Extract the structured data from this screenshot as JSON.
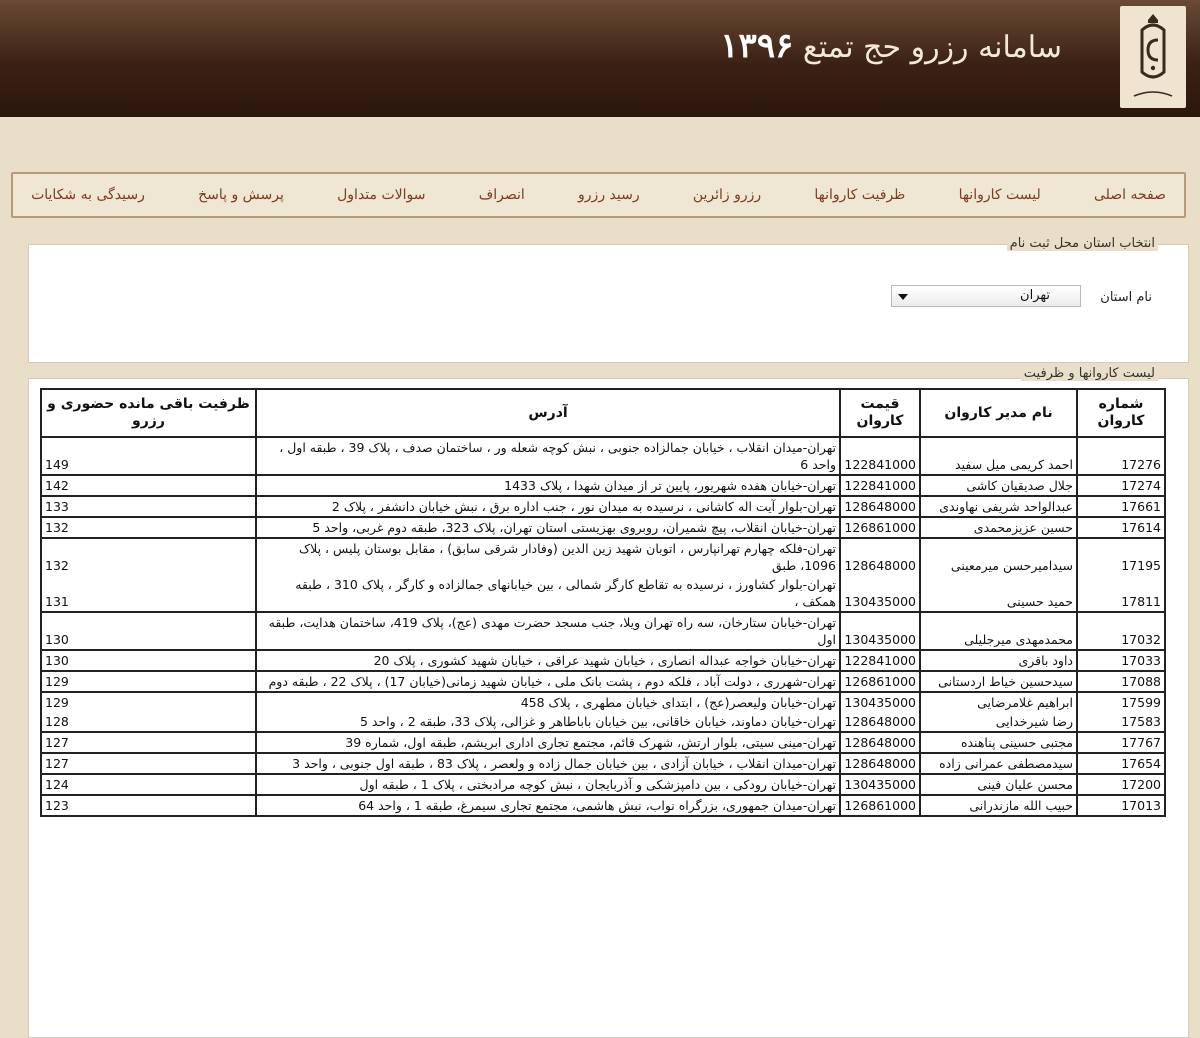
{
  "site": {
    "title": "سامانه رزرو حج تمتع",
    "year": "۱۳۹۶",
    "logo_text": "سازمان حج و زیارت"
  },
  "menu": [
    "صفحه اصلی",
    "لیست کاروانها",
    "ظرفیت کاروانها",
    "رزرو زائرین",
    "رسید رزرو",
    "انصراف",
    "سوالات متداول",
    "پرسش و پاسخ",
    "رسیدگی به شکایات"
  ],
  "province_panel": {
    "legend": "انتخاب استان محل ثبت نام",
    "label": "نام استان",
    "selected": "تهران"
  },
  "list_panel": {
    "legend": "لیست کاروانها و ظرفیت"
  },
  "table": {
    "headers": {
      "number": "شماره کاروان",
      "manager": "نام مدیر کاروان",
      "price": "قیمت کاروان",
      "address": "آدرس",
      "capacity": "ظرفیت باقی مانده حضوری و رزرو"
    },
    "rows": [
      {
        "number": "17276",
        "manager": "احمد کریمی میل سفید",
        "price": "122841000",
        "address": "تهران-میدان انقلاب ، خیابان جمالزاده جنوبی ، نبش کوچه شعله ور ، ساختمان صدف ، پلاک 39 ، طبقه اول ، واحد 6",
        "capacity": "149",
        "end": true
      },
      {
        "number": "17274",
        "manager": "جلال صدیقیان کاشی",
        "price": "122841000",
        "address": "تهران-خیابان هفده شهریور، پایین تر از میدان شهدا ، پلاک 1433",
        "capacity": "142",
        "end": true
      },
      {
        "number": "17661",
        "manager": "عبدالواحد شریفی نهاوندی",
        "price": "128648000",
        "address": "تهران-بلوار آیت اله کاشانی ، نرسیده به میدان نور ، جنب اداره برق ، نبش خیابان دانشفر ، پلاک 2",
        "capacity": "133",
        "end": true
      },
      {
        "number": "17614",
        "manager": "حسین عزیزمحمدی",
        "price": "126861000",
        "address": "تهران-خیابان انقلاب، پیچ شمیران، روبروی بهزیستی استان تهران، پلاک 323، طبقه دوم غربی، واحد 5",
        "capacity": "132",
        "end": true
      },
      {
        "number": "17195",
        "manager": "سیدامیرحسن میرمعینی",
        "price": "128648000",
        "address": "تهران-فلکه چهارم تهرانپارس ، اتوبان شهید زین الدین (وفادار شرقی سابق) ، مقابل بوستان پلیس ، پلاک 1096، طبق",
        "capacity": "132",
        "end": false
      },
      {
        "number": "17811",
        "manager": "حمید حسینی",
        "price": "130435000",
        "address": "تهران-بلوار کشاورز ، نرسیده به تقاطع کارگر شمالی ، بین خیابانهای جمالزاده و کارگر ، پلاک 310 ، طبقه همکف ،",
        "capacity": "131",
        "end": true
      },
      {
        "number": "17032",
        "manager": "محمدمهدی میرجلیلی",
        "price": "130435000",
        "address": "تهران-خیابان ستارخان، سه راه تهران ویلا، جنب مسجد حضرت مهدی (عج)، پلاک 419، ساختمان هدایت، طبقه اول",
        "capacity": "130",
        "end": true
      },
      {
        "number": "17033",
        "manager": "داود باقری",
        "price": "122841000",
        "address": "تهران-خیابان خواجه عبداله انصاری ، خیابان شهید عراقی ، خیابان شهید کشوری ، پلاک 20",
        "capacity": "130",
        "end": true
      },
      {
        "number": "17088",
        "manager": "سیدحسین خیاط اردستانی",
        "price": "126861000",
        "address": "تهران-شهرری ، دولت آباد ، فلکه دوم ، پشت بانک ملی ، خیابان شهید زمانی(خیابان 17) ، پلاک 22 ، طبقه دوم",
        "capacity": "129",
        "end": true
      },
      {
        "number": "17599",
        "manager": "ابراهیم غلامرضایی",
        "price": "130435000",
        "address": "تهران-خیابان ولیعصر(عج) ، ابتدای خیابان مطهری ، پلاک 458",
        "capacity": "129",
        "end": false
      },
      {
        "number": "17583",
        "manager": "رضا شیرخدایی",
        "price": "128648000",
        "address": "تهران-خیابان دماوند، خیابان خاقانی، بین خیابان باباطاهر و غزالی، پلاک 33، طبقه 2 ، واحد 5",
        "capacity": "128",
        "end": true
      },
      {
        "number": "17767",
        "manager": "مجتبی حسینی پناهنده",
        "price": "128648000",
        "address": "تهران-مینی سیتی، بلوار ارتش، شهرک قائم، مجتمع تجاری اداری ابریشم، طبقه اول، شماره 39",
        "capacity": "127",
        "end": true
      },
      {
        "number": "17654",
        "manager": "سیدمصطفی عمرانی زاده",
        "price": "128648000",
        "address": "تهران-میدان انقلاب ، خیابان آزادی ، بین خیابان جمال زاده و ولعصر ، پلاک 83 ، طبقه اول جنوبی ، واحد 3",
        "capacity": "127",
        "end": true
      },
      {
        "number": "17200",
        "manager": "محسن علیان فینی",
        "price": "130435000",
        "address": "تهران-خیابان رودکی ، بین دامپزشکی و آذربایجان ، نبش کوچه مرادبختی ، پلاک 1 ، طبقه اول",
        "capacity": "124",
        "end": true
      },
      {
        "number": "17013",
        "manager": "حبیب الله مازندرانی",
        "price": "126861000",
        "address": "تهران-میدان جمهوری، بزرگراه نواب، نبش هاشمی، مجتمع تجاری سیمرغ، طبقه 1 ، واحد 64",
        "capacity": "123",
        "end": true
      }
    ]
  }
}
